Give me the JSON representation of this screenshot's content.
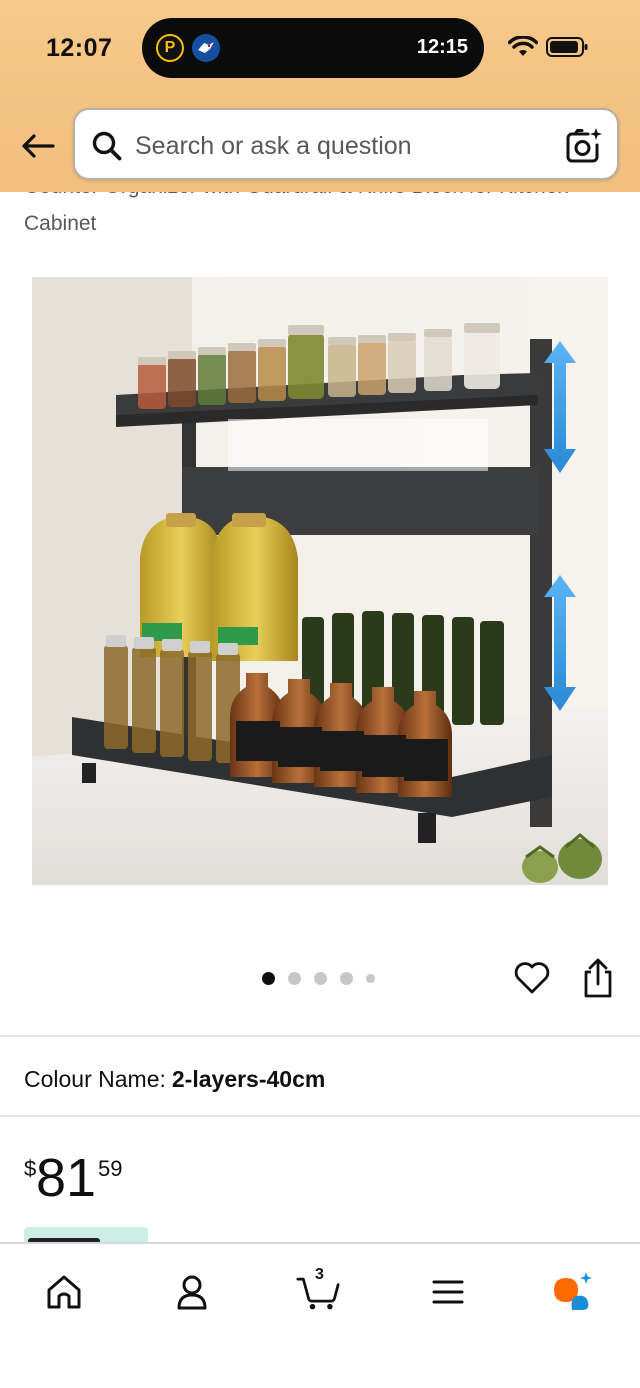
{
  "status_bar": {
    "time": "12:07",
    "island_time": "12:15",
    "island_app_letter": "P"
  },
  "search": {
    "placeholder": "Search or ask a question"
  },
  "product": {
    "title_line1": "Counter Organizer with Guardrail & Knife Block for Kitchen",
    "title_line2": "Cabinet",
    "image_count": 5,
    "active_image": 1
  },
  "variant": {
    "label": "Colour Name:",
    "value": "2-layers-40cm"
  },
  "price": {
    "currency": "$",
    "whole": "81",
    "fraction": "59"
  },
  "cart": {
    "count": "3"
  },
  "nav": {
    "items": [
      "home-icon",
      "account-icon",
      "cart-icon",
      "menu-icon",
      "rufus-icon"
    ]
  },
  "colors": {
    "header": "#f4c283",
    "accent": "#ff6a00",
    "rufus_blue": "#1a8ed8"
  }
}
